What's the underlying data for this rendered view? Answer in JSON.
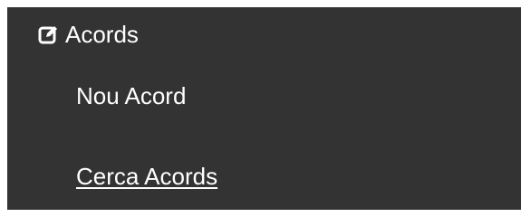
{
  "menu": {
    "section": {
      "title": "Acords",
      "icon": "edit-square-icon"
    },
    "items": [
      {
        "label": "Nou Acord"
      },
      {
        "label": "Cerca Acords"
      }
    ],
    "colors": {
      "background": "#333333",
      "text": "#ffffff"
    }
  }
}
